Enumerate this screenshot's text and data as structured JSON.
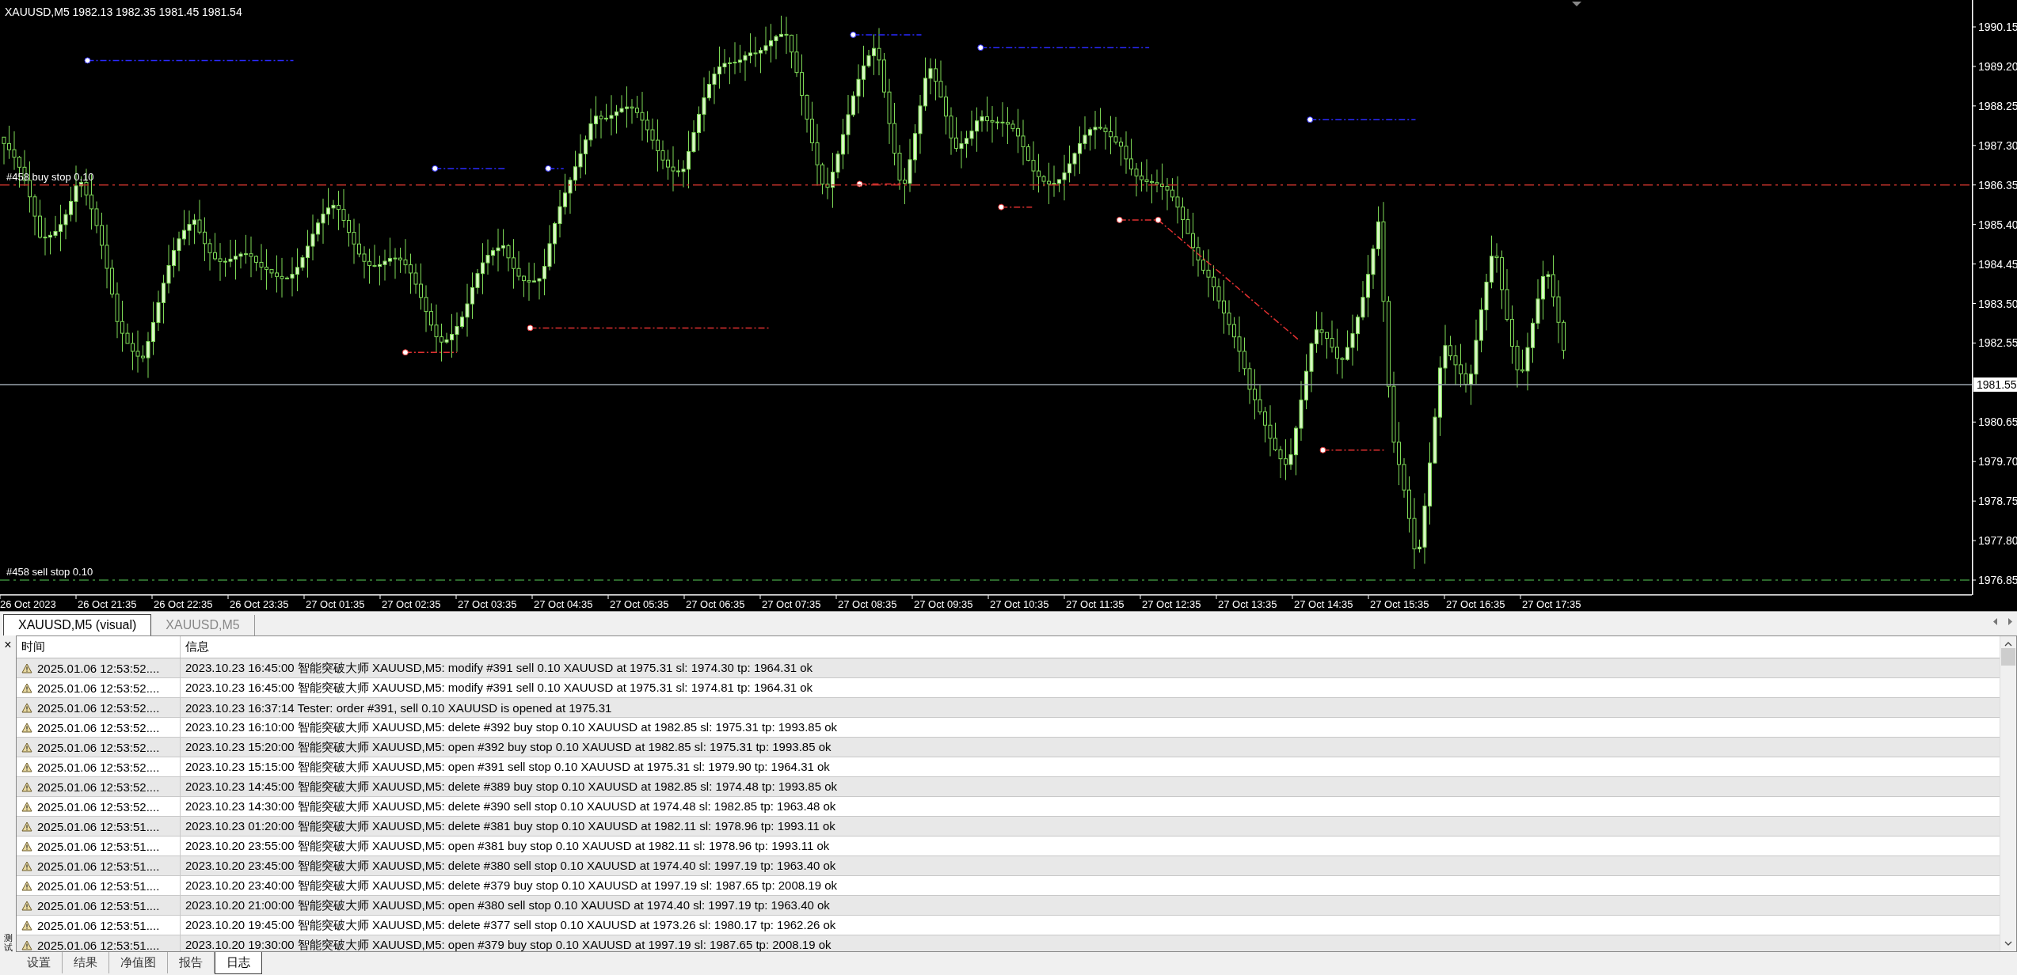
{
  "chart": {
    "symbol": "XAUUSD,M5",
    "ohlc": "1982.13 1982.35 1981.45 1981.54",
    "price_ticks": [
      {
        "label": "1990.15"
      },
      {
        "label": "1989.20"
      },
      {
        "label": "1988.25"
      },
      {
        "label": "1987.30"
      },
      {
        "label": "1986.35",
        "order": {
          "text": "#458 buy stop 0.10",
          "kind": "buy"
        }
      },
      {
        "label": "1985.40"
      },
      {
        "label": "1984.45"
      },
      {
        "label": "1983.50"
      },
      {
        "label": "1982.55"
      },
      {
        "label": "1980.65"
      },
      {
        "label": "1979.70"
      },
      {
        "label": "1978.75"
      },
      {
        "label": "1977.80"
      },
      {
        "label": "1976.85",
        "order": {
          "text": "#458 sell stop 0.10",
          "kind": "sell"
        }
      }
    ],
    "current_price": "1981.55",
    "time_labels": [
      "26 Oct 2023",
      "26 Oct 21:35",
      "26 Oct 22:35",
      "26 Oct 23:35",
      "27 Oct 01:35",
      "27 Oct 02:35",
      "27 Oct 03:35",
      "27 Oct 04:35",
      "27 Oct 05:35",
      "27 Oct 06:35",
      "27 Oct 07:35",
      "27 Oct 08:35",
      "27 Oct 09:35",
      "27 Oct 10:35",
      "27 Oct 11:35",
      "27 Oct 12:35",
      "27 Oct 13:35",
      "27 Oct 14:35",
      "27 Oct 15:35",
      "27 Oct 16:35",
      "27 Oct 17:35"
    ]
  },
  "chart_tabs": [
    {
      "label": "XAUUSD,M5 (visual)",
      "selected": true
    },
    {
      "label": "XAUUSD,M5",
      "selected": false
    }
  ],
  "log": {
    "columns": [
      "时间",
      "信息"
    ],
    "rows": [
      {
        "time": "2025.01.06 12:53:52....",
        "message": "2023.10.23 16:45:00  智能突破大师 XAUUSD,M5: modify #391 sell 0.10 XAUUSD at 1975.31 sl: 1974.30 tp: 1964.31 ok"
      },
      {
        "time": "2025.01.06 12:53:52....",
        "message": "2023.10.23 16:45:00  智能突破大师 XAUUSD,M5: modify #391 sell 0.10 XAUUSD at 1975.31 sl: 1974.81 tp: 1964.31 ok"
      },
      {
        "time": "2025.01.06 12:53:52....",
        "message": "2023.10.23 16:37:14  Tester: order #391, sell 0.10 XAUUSD is opened at 1975.31"
      },
      {
        "time": "2025.01.06 12:53:52....",
        "message": "2023.10.23 16:10:00  智能突破大师 XAUUSD,M5: delete #392 buy stop 0.10 XAUUSD at 1982.85 sl: 1975.31 tp: 1993.85 ok"
      },
      {
        "time": "2025.01.06 12:53:52....",
        "message": "2023.10.23 15:20:00  智能突破大师 XAUUSD,M5: open #392 buy stop 0.10 XAUUSD at 1982.85 sl: 1975.31 tp: 1993.85 ok"
      },
      {
        "time": "2025.01.06 12:53:52....",
        "message": "2023.10.23 15:15:00  智能突破大师 XAUUSD,M5: open #391 sell stop 0.10 XAUUSD at 1975.31 sl: 1979.90 tp: 1964.31 ok"
      },
      {
        "time": "2025.01.06 12:53:52....",
        "message": "2023.10.23 14:45:00  智能突破大师 XAUUSD,M5: delete #389 buy stop 0.10 XAUUSD at 1982.85 sl: 1974.48 tp: 1993.85 ok"
      },
      {
        "time": "2025.01.06 12:53:52....",
        "message": "2023.10.23 14:30:00  智能突破大师 XAUUSD,M5: delete #390 sell stop 0.10 XAUUSD at 1974.48 sl: 1982.85 tp: 1963.48 ok"
      },
      {
        "time": "2025.01.06 12:53:51....",
        "message": "2023.10.23 01:20:00  智能突破大师 XAUUSD,M5: delete #381 buy stop 0.10 XAUUSD at 1982.11 sl: 1978.96 tp: 1993.11 ok"
      },
      {
        "time": "2025.01.06 12:53:51....",
        "message": "2023.10.20 23:55:00  智能突破大师 XAUUSD,M5: open #381 buy stop 0.10 XAUUSD at 1982.11 sl: 1978.96 tp: 1993.11 ok"
      },
      {
        "time": "2025.01.06 12:53:51....",
        "message": "2023.10.20 23:45:00  智能突破大师 XAUUSD,M5: delete #380 sell stop 0.10 XAUUSD at 1974.40 sl: 1997.19 tp: 1963.40 ok"
      },
      {
        "time": "2025.01.06 12:53:51....",
        "message": "2023.10.20 23:40:00  智能突破大师 XAUUSD,M5: delete #379 buy stop 0.10 XAUUSD at 1997.19 sl: 1987.65 tp: 2008.19 ok"
      },
      {
        "time": "2025.01.06 12:53:51....",
        "message": "2023.10.20 21:00:00  智能突破大师 XAUUSD,M5: open #380 sell stop 0.10 XAUUSD at 1974.40 sl: 1997.19 tp: 1963.40 ok"
      },
      {
        "time": "2025.01.06 12:53:51....",
        "message": "2023.10.20 19:45:00  智能突破大师 XAUUSD,M5: delete #377 sell stop 0.10 XAUUSD at 1973.26 sl: 1980.17 tp: 1962.26 ok"
      },
      {
        "time": "2025.01.06 12:53:51....",
        "message": "2023.10.20 19:30:00  智能突破大师 XAUUSD,M5: open #379 buy stop 0.10 XAUUSD at 1997.19 sl: 1987.65 tp: 2008.19 ok"
      }
    ]
  },
  "close_label": "×",
  "side_label": "测试",
  "bottom_tabs": [
    {
      "label": "设置",
      "selected": false
    },
    {
      "label": "结果",
      "selected": false
    },
    {
      "label": "净值图",
      "selected": false
    },
    {
      "label": "报告",
      "selected": false
    },
    {
      "label": "日志",
      "selected": true
    }
  ]
}
